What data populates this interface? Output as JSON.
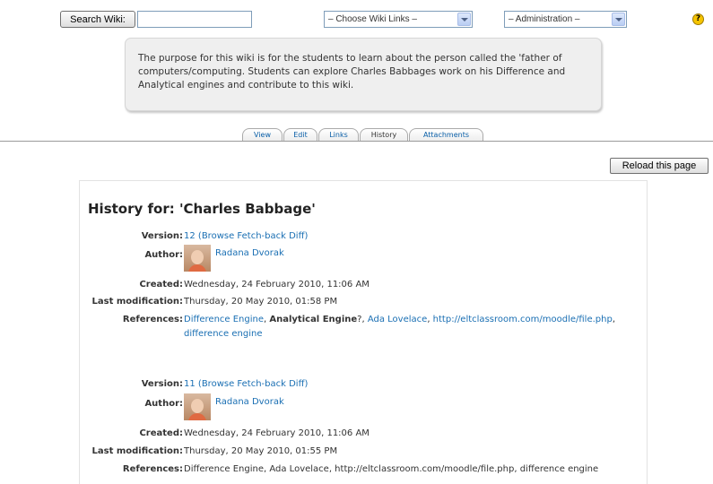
{
  "topbar": {
    "search_button": "Search Wiki:",
    "search_value": "",
    "wiki_links_select": "– Choose Wiki Links –",
    "admin_select": "– Administration –",
    "help_glyph": "?"
  },
  "summary": "The purpose for this wiki is for the students to learn about the person called the 'father of computers/computing. Students can explore Charles Babbages work on his Difference and Analytical engines and contribute to this wiki.",
  "tabs": [
    "View",
    "Edit",
    "Links",
    "History",
    "Attachments"
  ],
  "active_tab": "History",
  "reload_button": "Reload this page",
  "history": {
    "title": "History for: 'Charles Babbage'",
    "labels": {
      "version": "Version:",
      "author": "Author:",
      "created": "Created:",
      "last_modification": "Last modification:",
      "references": "References:"
    },
    "entries": [
      {
        "version": "12",
        "browse": "(Browse",
        "fetch_back": "Fetch-back",
        "diff": "Diff)",
        "author": "Radana Dvorak",
        "created": "Wednesday, 24 February 2010, 11:06 AM",
        "last_modification": "Thursday, 20 May 2010, 01:58 PM",
        "references": {
          "ref1": "Difference Engine",
          "sep1": ", ",
          "ref2": "Analytical Engine",
          "sep2": "?, ",
          "ref3": "Ada Lovelace",
          "sep3": ", ",
          "ref4": "http://eltclassroom.com/moodle/file.php",
          "sep4": ", ",
          "ref5": "difference engine"
        }
      },
      {
        "version": "11",
        "browse": "(Browse",
        "fetch_back": "Fetch-back",
        "diff": "Diff)",
        "author": "Radana Dvorak",
        "created": "Wednesday, 24 February 2010, 11:06 AM",
        "last_modification": "Thursday, 20 May 2010, 01:55 PM",
        "references_text": "Difference Engine, Ada Lovelace, http://eltclassroom.com/moodle/file.php, difference engine"
      }
    ]
  }
}
